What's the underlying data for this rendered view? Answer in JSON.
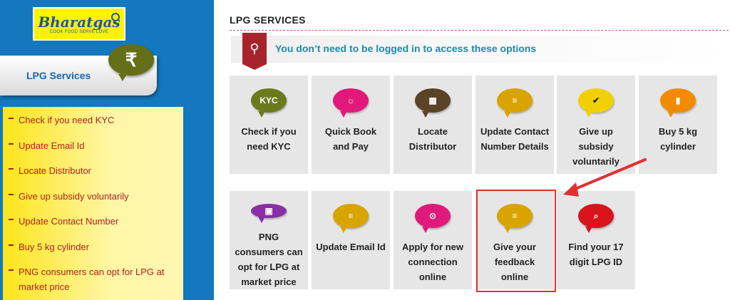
{
  "logo": {
    "name": "Bharatgas",
    "tagline": "COOK FOOD  SERVE LOVE"
  },
  "sidebar": {
    "tab_label": "LPG Services",
    "tab_icon": "rupee-icon",
    "tab_glyph": "₹",
    "items": [
      {
        "label": "Check if you need KYC"
      },
      {
        "label": "Update Email Id"
      },
      {
        "label": "Locate Distributor"
      },
      {
        "label": "Give up subsidy voluntarily"
      },
      {
        "label": "Update Contact Number"
      },
      {
        "label": "Buy 5 kg cylinder"
      },
      {
        "label": "PNG consumers can opt for LPG at market price"
      }
    ]
  },
  "main": {
    "heading": "LPG SERVICES",
    "notice": "You don’t need to be logged in to access these options",
    "notice_icon": "search-icon",
    "tiles_row1": [
      {
        "label": "Check if you need KYC",
        "icon": "kyc-icon",
        "glyph": "KYC",
        "color": "#6b7a1c"
      },
      {
        "label": "Quick Book and Pay",
        "icon": "booking-icon",
        "glyph": "☼",
        "color": "#e0197a"
      },
      {
        "label": "Locate Distributor",
        "icon": "map-icon",
        "glyph": "▦",
        "color": "#5a4326"
      },
      {
        "label": "Update Contact Number Details",
        "icon": "message-icon",
        "glyph": "≡",
        "color": "#d9a300"
      },
      {
        "label": "Give up subsidy voluntarily",
        "icon": "checkmark-icon",
        "glyph": "✔",
        "color": "#f2d000"
      },
      {
        "label": "Buy 5 kg cylinder",
        "icon": "cylinder-icon",
        "glyph": "▮",
        "color": "#f28b00"
      }
    ],
    "tiles_row2": [
      {
        "label": "PNG consumers can opt for LPG at market price",
        "icon": "png-icon",
        "glyph": "▣",
        "color": "#8a2ea8"
      },
      {
        "label": "Update Email Id",
        "icon": "message-icon",
        "glyph": "≡",
        "color": "#d9a300"
      },
      {
        "label": "Apply for new connection online",
        "icon": "connection-icon",
        "glyph": "⊙",
        "color": "#e0197a"
      },
      {
        "label": "Give your feedback online",
        "icon": "feedback-icon",
        "glyph": "≡",
        "color": "#d9a300"
      },
      {
        "label": "Find your 17 digit LPG ID",
        "icon": "search-icon",
        "glyph": "⌕",
        "color": "#d9141c"
      }
    ],
    "accent": "#e23030"
  }
}
